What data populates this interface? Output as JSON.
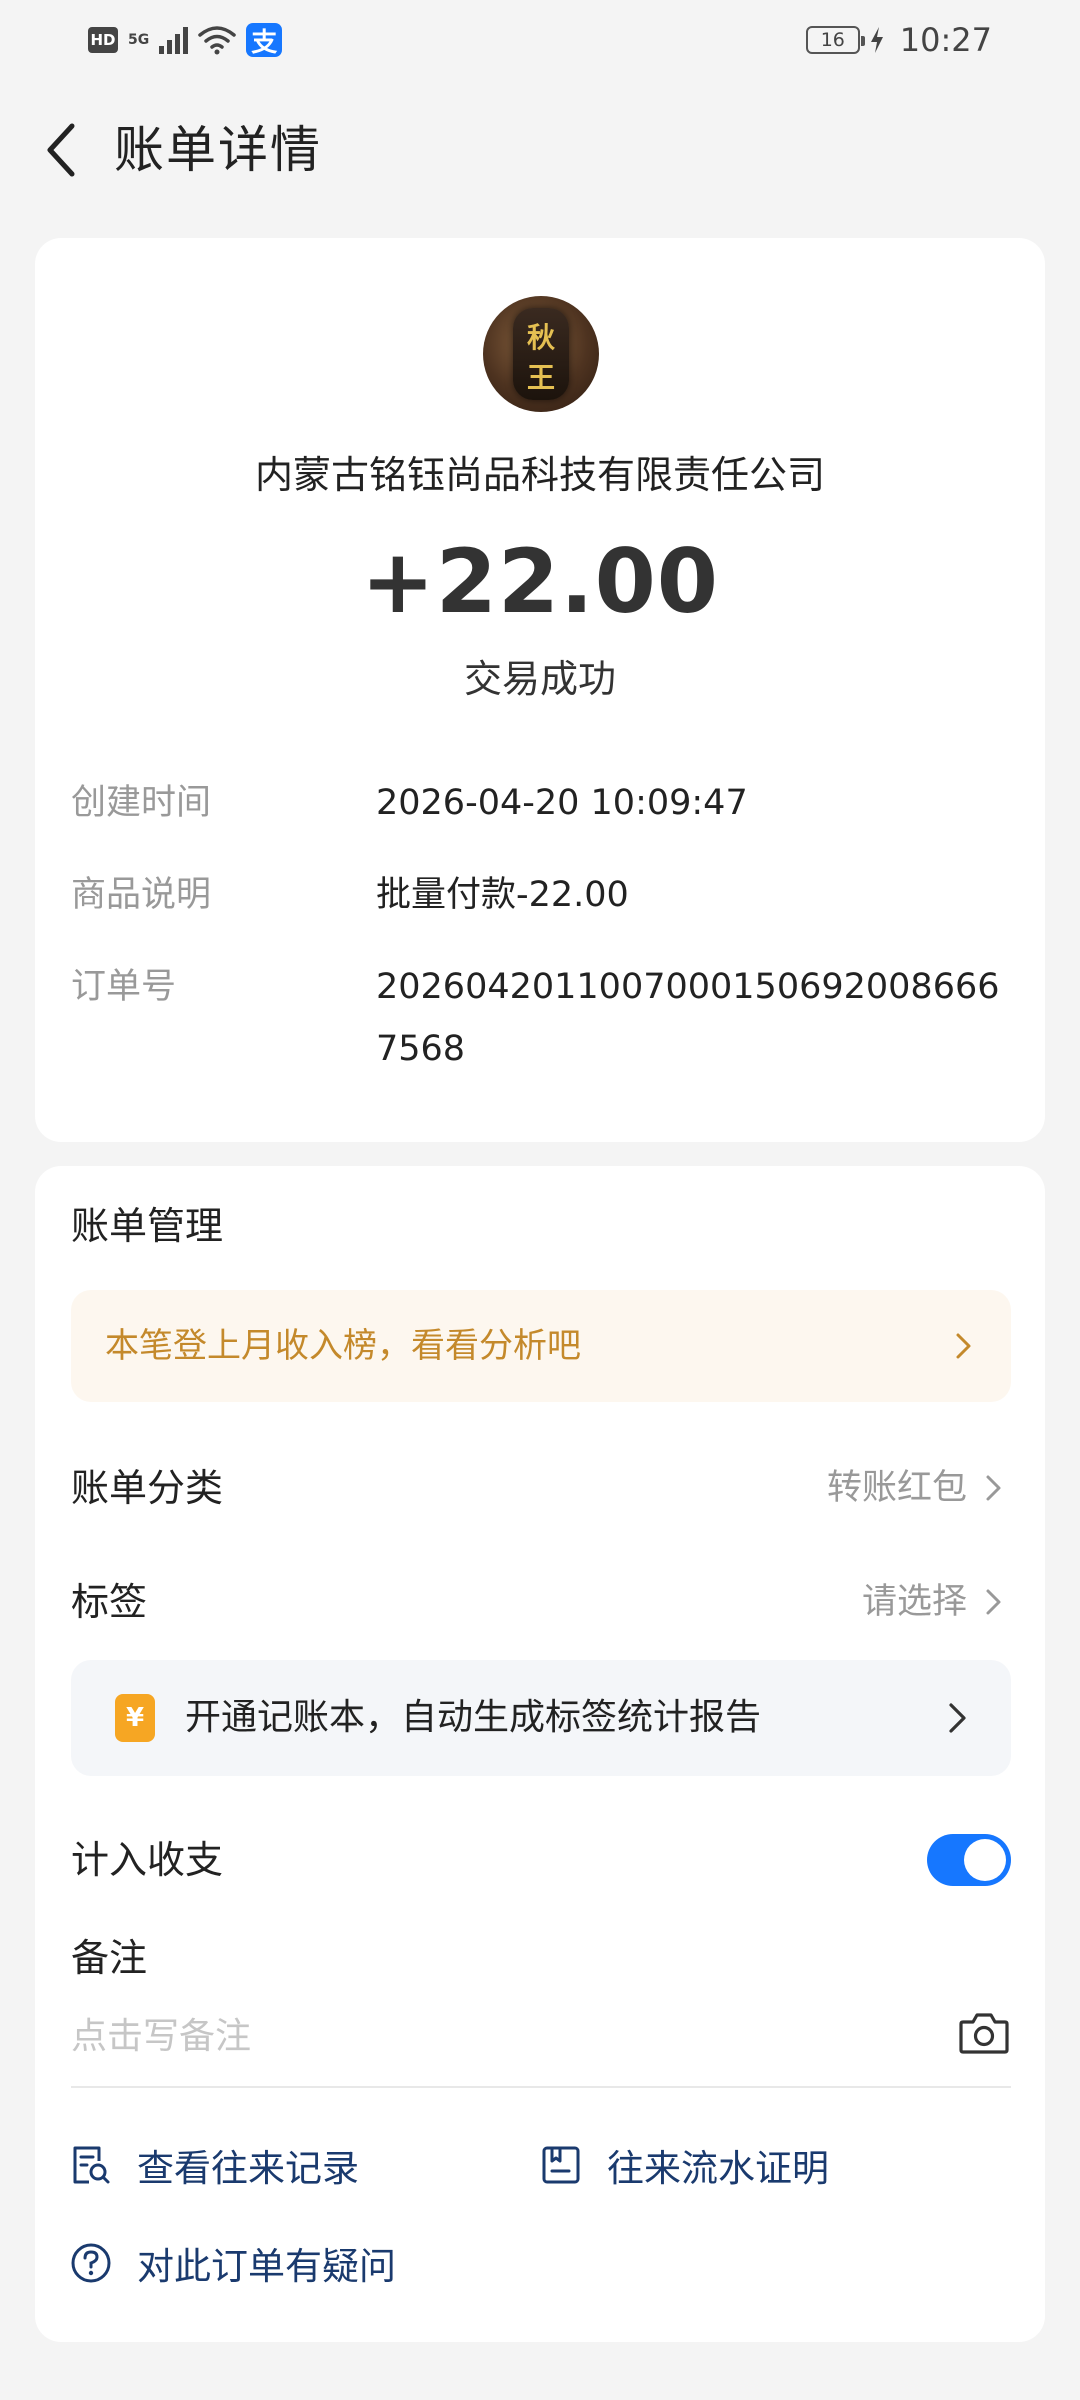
{
  "status_bar": {
    "hd": "HD",
    "network": "5G",
    "alipay_icon": "支",
    "battery": "16",
    "time": "10:27"
  },
  "header": {
    "title": "账单详情"
  },
  "bill": {
    "merchant": "内蒙古铭钰尚品科技有限责任公司",
    "avatar_text": [
      "秋",
      "王"
    ],
    "amount": "+22.00",
    "status": "交易成功",
    "details": [
      {
        "label": "创建时间",
        "value": "2026-04-20 10:09:47"
      },
      {
        "label": "商品说明",
        "value": "批量付款-22.00"
      },
      {
        "label": "订单号",
        "value": "20260420110070001506920086667568"
      }
    ]
  },
  "manage": {
    "title": "账单管理",
    "promo_text": "本笔登上月收入榜，看看分析吧",
    "category_label": "账单分类",
    "category_value": "转账红包",
    "tag_label": "标签",
    "tag_value": "请选择",
    "notebook_icon": "¥",
    "notebook_text": "开通记账本，自动生成标签统计报告",
    "include_label": "计入收支",
    "include_on": true,
    "remark_label": "备注",
    "remark_placeholder": "点击写备注",
    "links": {
      "records": "查看往来记录",
      "proof": "往来流水证明",
      "question": "对此订单有疑问"
    }
  },
  "colors": {
    "accent": "#1677ff",
    "promo_text": "#c4892b",
    "link_text": "#1a3a6e",
    "background": "#f4f4f4"
  },
  "icons": [
    "back-arrow-icon",
    "chevron-right-icon",
    "camera-icon",
    "records-search-icon",
    "document-proof-icon",
    "question-circle-icon",
    "yuan-notebook-icon"
  ]
}
